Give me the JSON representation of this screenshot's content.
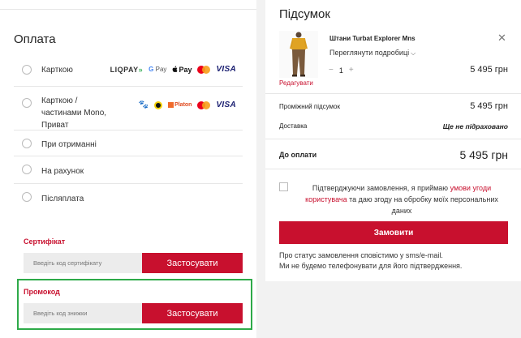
{
  "payment": {
    "title": "Оплата",
    "methods": [
      {
        "label": "Карткою"
      },
      {
        "label": "Карткою / частинами Mono, Приват"
      },
      {
        "label": "При отриманні"
      },
      {
        "label": "На рахунок"
      },
      {
        "label": "Післяплата"
      }
    ],
    "logos": {
      "liqpay": "LIQPAY",
      "liqpay_arrow": "»",
      "gpay_g": "G",
      "gpay_text": "Pay",
      "apay": "Pay",
      "apple_glyph": "",
      "visa": "VISA",
      "platon": "Platon",
      "paw": "🐾"
    },
    "certificate": {
      "label": "Сертифікат",
      "placeholder": "Введіть код сертифікату",
      "button": "Застосувати"
    },
    "promo": {
      "label": "Промокод",
      "placeholder": "Введіть код знижки",
      "button": "Застосувати"
    }
  },
  "summary": {
    "title": "Підсумок",
    "product": {
      "name": "Штани Turbat Explorer Mns",
      "details_link": "Переглянути подробиці",
      "chevron": "⌵",
      "remove": "✕",
      "qty_minus": "−",
      "qty": "1",
      "qty_plus": "+",
      "price": "5 495 грн",
      "edit": "Редагувати"
    },
    "subtotal_label": "Проміжний підсумок",
    "subtotal_value": "5 495 грн",
    "delivery_label": "Доставка",
    "delivery_value": "Ще не підраховано",
    "total_label": "До оплати",
    "total_value": "5 495 грн",
    "agreement": {
      "before": "Підтверджуючи замовлення, я приймаю ",
      "link": "умови угоди користувача",
      "after": " та даю згоду на обробку моїх персональних даних"
    },
    "order_button": "Замовити",
    "notice_line1": "Про статус замовлення сповістимо у sms/e-mail.",
    "notice_line2": "Ми не будемо телефонувати для його підтвердження."
  },
  "colors": {
    "accent": "#c8102e",
    "highlight": "#2eaa49",
    "pants": "#7a5a3c",
    "shirt": "#e0a323"
  }
}
